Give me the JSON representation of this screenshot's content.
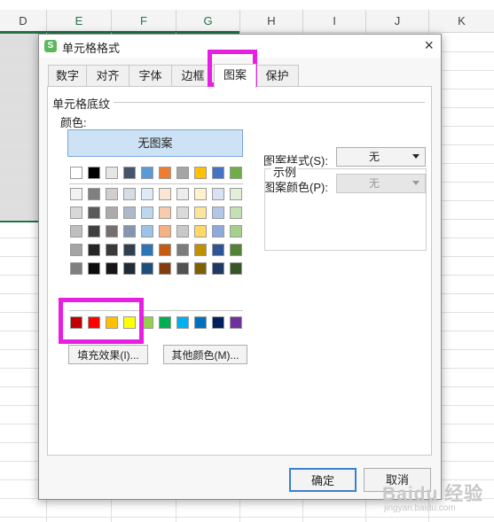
{
  "sheet": {
    "columns": [
      "D",
      "E",
      "F",
      "G",
      "H",
      "I",
      "J",
      "K"
    ]
  },
  "dialog": {
    "title": "单元格格式",
    "close_glyph": "×",
    "tabs": [
      "数字",
      "对齐",
      "字体",
      "边框",
      "图案",
      "保护"
    ],
    "active_tab": "图案",
    "section_title": "单元格底纹",
    "color_label": "颜色:",
    "no_pattern_label": "无图案",
    "fill_effects_label": "填充效果(I)...",
    "more_colors_label": "其他颜色(M)...",
    "pattern_style_label": "图案样式(S):",
    "pattern_style_value": "无",
    "pattern_color_label": "图案颜色(P):",
    "pattern_color_value": "无",
    "sample_label": "示例",
    "ok_label": "确定",
    "cancel_label": "取消",
    "palette": {
      "theme_row": [
        "#ffffff",
        "#000000",
        "#e7e6e6",
        "#44546a",
        "#5b9bd5",
        "#ed7d31",
        "#a5a5a5",
        "#ffc000",
        "#4472c4",
        "#70ad47"
      ],
      "tint_rows": [
        [
          "#f2f2f2",
          "#7f7f7f",
          "#d0cece",
          "#d6dce4",
          "#deebf6",
          "#fbe5d5",
          "#ededed",
          "#fff2cc",
          "#d9e2f3",
          "#e2efd9"
        ],
        [
          "#d8d8d8",
          "#595959",
          "#aeaaaa",
          "#adb9ca",
          "#bdd7ee",
          "#f7cbac",
          "#dbdbdb",
          "#fee599",
          "#b4c6e7",
          "#c5e0b3"
        ],
        [
          "#bfbfbf",
          "#3f3f3f",
          "#757070",
          "#8496b0",
          "#9dc3e6",
          "#f4b183",
          "#c9c9c9",
          "#ffd965",
          "#8eaadb",
          "#a8d08d"
        ],
        [
          "#a5a5a5",
          "#262626",
          "#3a3838",
          "#323f4f",
          "#2e75b5",
          "#c55a11",
          "#7b7b7b",
          "#bf9000",
          "#2f5496",
          "#538135"
        ],
        [
          "#7f7f7f",
          "#0c0c0c",
          "#171616",
          "#222a35",
          "#1e4e79",
          "#843c0b",
          "#525252",
          "#7f6000",
          "#1f3864",
          "#375623"
        ]
      ],
      "standard_row": [
        "#c00000",
        "#ff0000",
        "#ffc000",
        "#ffff00",
        "#92d050",
        "#00b050",
        "#00b0f0",
        "#0070c0",
        "#002060",
        "#7030a0"
      ]
    }
  },
  "colors": {
    "highlight": "#e91ee3",
    "selection_accent": "#217346"
  },
  "watermark": {
    "text": "Baidu 经验",
    "sub": "jingyan.baidu.com"
  }
}
